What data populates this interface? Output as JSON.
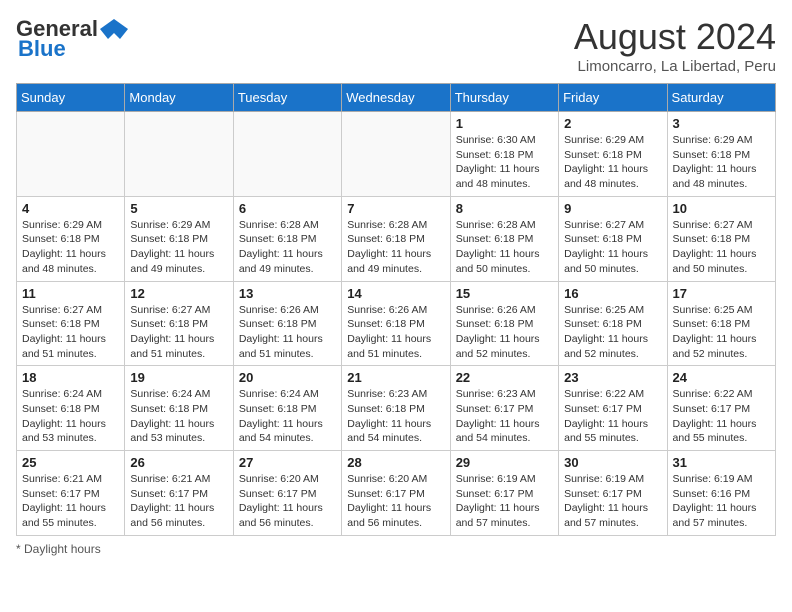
{
  "logo": {
    "general": "General",
    "blue": "Blue"
  },
  "title": "August 2024",
  "subtitle": "Limoncarro, La Libertad, Peru",
  "days_of_week": [
    "Sunday",
    "Monday",
    "Tuesday",
    "Wednesday",
    "Thursday",
    "Friday",
    "Saturday"
  ],
  "weeks": [
    [
      {
        "day": "",
        "info": ""
      },
      {
        "day": "",
        "info": ""
      },
      {
        "day": "",
        "info": ""
      },
      {
        "day": "",
        "info": ""
      },
      {
        "day": "1",
        "info": "Sunrise: 6:30 AM\nSunset: 6:18 PM\nDaylight: 11 hours and 48 minutes."
      },
      {
        "day": "2",
        "info": "Sunrise: 6:29 AM\nSunset: 6:18 PM\nDaylight: 11 hours and 48 minutes."
      },
      {
        "day": "3",
        "info": "Sunrise: 6:29 AM\nSunset: 6:18 PM\nDaylight: 11 hours and 48 minutes."
      }
    ],
    [
      {
        "day": "4",
        "info": "Sunrise: 6:29 AM\nSunset: 6:18 PM\nDaylight: 11 hours and 48 minutes."
      },
      {
        "day": "5",
        "info": "Sunrise: 6:29 AM\nSunset: 6:18 PM\nDaylight: 11 hours and 49 minutes."
      },
      {
        "day": "6",
        "info": "Sunrise: 6:28 AM\nSunset: 6:18 PM\nDaylight: 11 hours and 49 minutes."
      },
      {
        "day": "7",
        "info": "Sunrise: 6:28 AM\nSunset: 6:18 PM\nDaylight: 11 hours and 49 minutes."
      },
      {
        "day": "8",
        "info": "Sunrise: 6:28 AM\nSunset: 6:18 PM\nDaylight: 11 hours and 50 minutes."
      },
      {
        "day": "9",
        "info": "Sunrise: 6:27 AM\nSunset: 6:18 PM\nDaylight: 11 hours and 50 minutes."
      },
      {
        "day": "10",
        "info": "Sunrise: 6:27 AM\nSunset: 6:18 PM\nDaylight: 11 hours and 50 minutes."
      }
    ],
    [
      {
        "day": "11",
        "info": "Sunrise: 6:27 AM\nSunset: 6:18 PM\nDaylight: 11 hours and 51 minutes."
      },
      {
        "day": "12",
        "info": "Sunrise: 6:27 AM\nSunset: 6:18 PM\nDaylight: 11 hours and 51 minutes."
      },
      {
        "day": "13",
        "info": "Sunrise: 6:26 AM\nSunset: 6:18 PM\nDaylight: 11 hours and 51 minutes."
      },
      {
        "day": "14",
        "info": "Sunrise: 6:26 AM\nSunset: 6:18 PM\nDaylight: 11 hours and 51 minutes."
      },
      {
        "day": "15",
        "info": "Sunrise: 6:26 AM\nSunset: 6:18 PM\nDaylight: 11 hours and 52 minutes."
      },
      {
        "day": "16",
        "info": "Sunrise: 6:25 AM\nSunset: 6:18 PM\nDaylight: 11 hours and 52 minutes."
      },
      {
        "day": "17",
        "info": "Sunrise: 6:25 AM\nSunset: 6:18 PM\nDaylight: 11 hours and 52 minutes."
      }
    ],
    [
      {
        "day": "18",
        "info": "Sunrise: 6:24 AM\nSunset: 6:18 PM\nDaylight: 11 hours and 53 minutes."
      },
      {
        "day": "19",
        "info": "Sunrise: 6:24 AM\nSunset: 6:18 PM\nDaylight: 11 hours and 53 minutes."
      },
      {
        "day": "20",
        "info": "Sunrise: 6:24 AM\nSunset: 6:18 PM\nDaylight: 11 hours and 54 minutes."
      },
      {
        "day": "21",
        "info": "Sunrise: 6:23 AM\nSunset: 6:18 PM\nDaylight: 11 hours and 54 minutes."
      },
      {
        "day": "22",
        "info": "Sunrise: 6:23 AM\nSunset: 6:17 PM\nDaylight: 11 hours and 54 minutes."
      },
      {
        "day": "23",
        "info": "Sunrise: 6:22 AM\nSunset: 6:17 PM\nDaylight: 11 hours and 55 minutes."
      },
      {
        "day": "24",
        "info": "Sunrise: 6:22 AM\nSunset: 6:17 PM\nDaylight: 11 hours and 55 minutes."
      }
    ],
    [
      {
        "day": "25",
        "info": "Sunrise: 6:21 AM\nSunset: 6:17 PM\nDaylight: 11 hours and 55 minutes."
      },
      {
        "day": "26",
        "info": "Sunrise: 6:21 AM\nSunset: 6:17 PM\nDaylight: 11 hours and 56 minutes."
      },
      {
        "day": "27",
        "info": "Sunrise: 6:20 AM\nSunset: 6:17 PM\nDaylight: 11 hours and 56 minutes."
      },
      {
        "day": "28",
        "info": "Sunrise: 6:20 AM\nSunset: 6:17 PM\nDaylight: 11 hours and 56 minutes."
      },
      {
        "day": "29",
        "info": "Sunrise: 6:19 AM\nSunset: 6:17 PM\nDaylight: 11 hours and 57 minutes."
      },
      {
        "day": "30",
        "info": "Sunrise: 6:19 AM\nSunset: 6:17 PM\nDaylight: 11 hours and 57 minutes."
      },
      {
        "day": "31",
        "info": "Sunrise: 6:19 AM\nSunset: 6:16 PM\nDaylight: 11 hours and 57 minutes."
      }
    ]
  ],
  "footer": "Daylight hours"
}
